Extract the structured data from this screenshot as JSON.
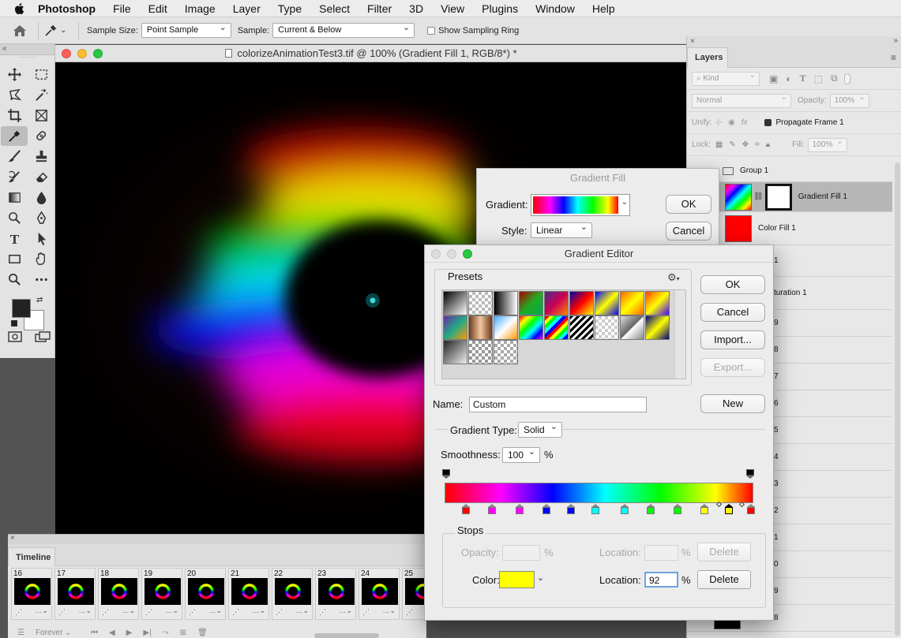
{
  "menubar": {
    "items": [
      "Photoshop",
      "File",
      "Edit",
      "Image",
      "Layer",
      "Type",
      "Select",
      "Filter",
      "3D",
      "View",
      "Plugins",
      "Window",
      "Help"
    ]
  },
  "options_bar": {
    "sample_size_label": "Sample Size:",
    "sample_size_value": "Point Sample",
    "sample_label": "Sample:",
    "sample_value": "Current & Below",
    "show_sampling_ring": "Show Sampling Ring"
  },
  "document": {
    "title": "colorizeAnimationTest3.tif @ 100% (Gradient Fill 1, RGB/8*) *"
  },
  "layers_panel": {
    "tab": "Layers",
    "kind": "Kind",
    "blend_mode": "Normal",
    "opacity_label": "Opacity:",
    "opacity_value": "100%",
    "unify_label": "Unify:",
    "propagate": "Propagate Frame 1",
    "lock_label": "Lock:",
    "fill_label": "Fill:",
    "fill_value": "100%",
    "group_name": "Group 1",
    "layers": [
      "Gradient Fill 1",
      "Color Fill 1"
    ],
    "partial_1": "1",
    "partial_saturation": "turation 1",
    "partial_numbers": [
      "9",
      "8",
      "7",
      "6",
      "5",
      "4",
      "3",
      "2",
      "1",
      "0",
      "9",
      "8"
    ]
  },
  "gradient_fill": {
    "title": "Gradient Fill",
    "gradient_label": "Gradient:",
    "style_label": "Style:",
    "style_value": "Linear",
    "ok": "OK",
    "cancel": "Cancel"
  },
  "gradient_editor": {
    "title": "Gradient Editor",
    "presets_label": "Presets",
    "ok": "OK",
    "cancel": "Cancel",
    "import": "Import...",
    "export": "Export...",
    "name_label": "Name:",
    "name_value": "Custom",
    "new": "New",
    "gradient_type_label": "Gradient Type:",
    "gradient_type_value": "Solid",
    "smoothness_label": "Smoothness:",
    "smoothness_value": "100",
    "percent": "%",
    "stops_label": "Stops",
    "opacity_label": "Opacity:",
    "location_label": "Location:",
    "delete": "Delete",
    "color_label": "Color:",
    "color_value": "#ffff00",
    "location_value": "92",
    "color_stops": [
      "#ff0000",
      "#ff00ff",
      "#ff00ff",
      "#0000ff",
      "#0000ff",
      "#00ffff",
      "#00ffff",
      "#00ff00",
      "#00ff00",
      "#ffff00",
      "#ffff00",
      "#ff0000"
    ]
  },
  "timeline": {
    "title": "Timeline",
    "frames": [
      "16",
      "17",
      "18",
      "19",
      "20",
      "21",
      "22",
      "23",
      "24",
      "25"
    ],
    "loop": "Forever"
  }
}
